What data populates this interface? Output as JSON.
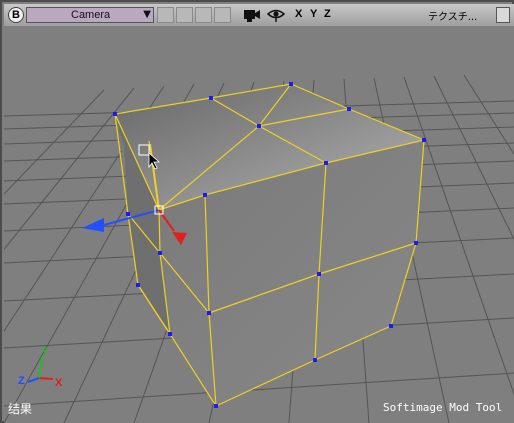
{
  "toolbar": {
    "viewport_button_label": "B",
    "camera_label": "Camera",
    "axis_labels": [
      "X",
      "Y",
      "Z"
    ],
    "texture_label": "テクスチ..."
  },
  "gizmo": {
    "x_label": "X",
    "y_label": "Y",
    "z_label": "Z"
  },
  "status": {
    "left_text": "结果",
    "right_text": "Softimage Mod Tool"
  },
  "colors": {
    "edge_highlight": "#f0d020",
    "vertex": "#1a1aff",
    "grid_line": "#555555",
    "background": "#7f7f7f",
    "x_axis": "#e02020",
    "y_axis": "#20c020",
    "z_axis": "#2050ff"
  }
}
